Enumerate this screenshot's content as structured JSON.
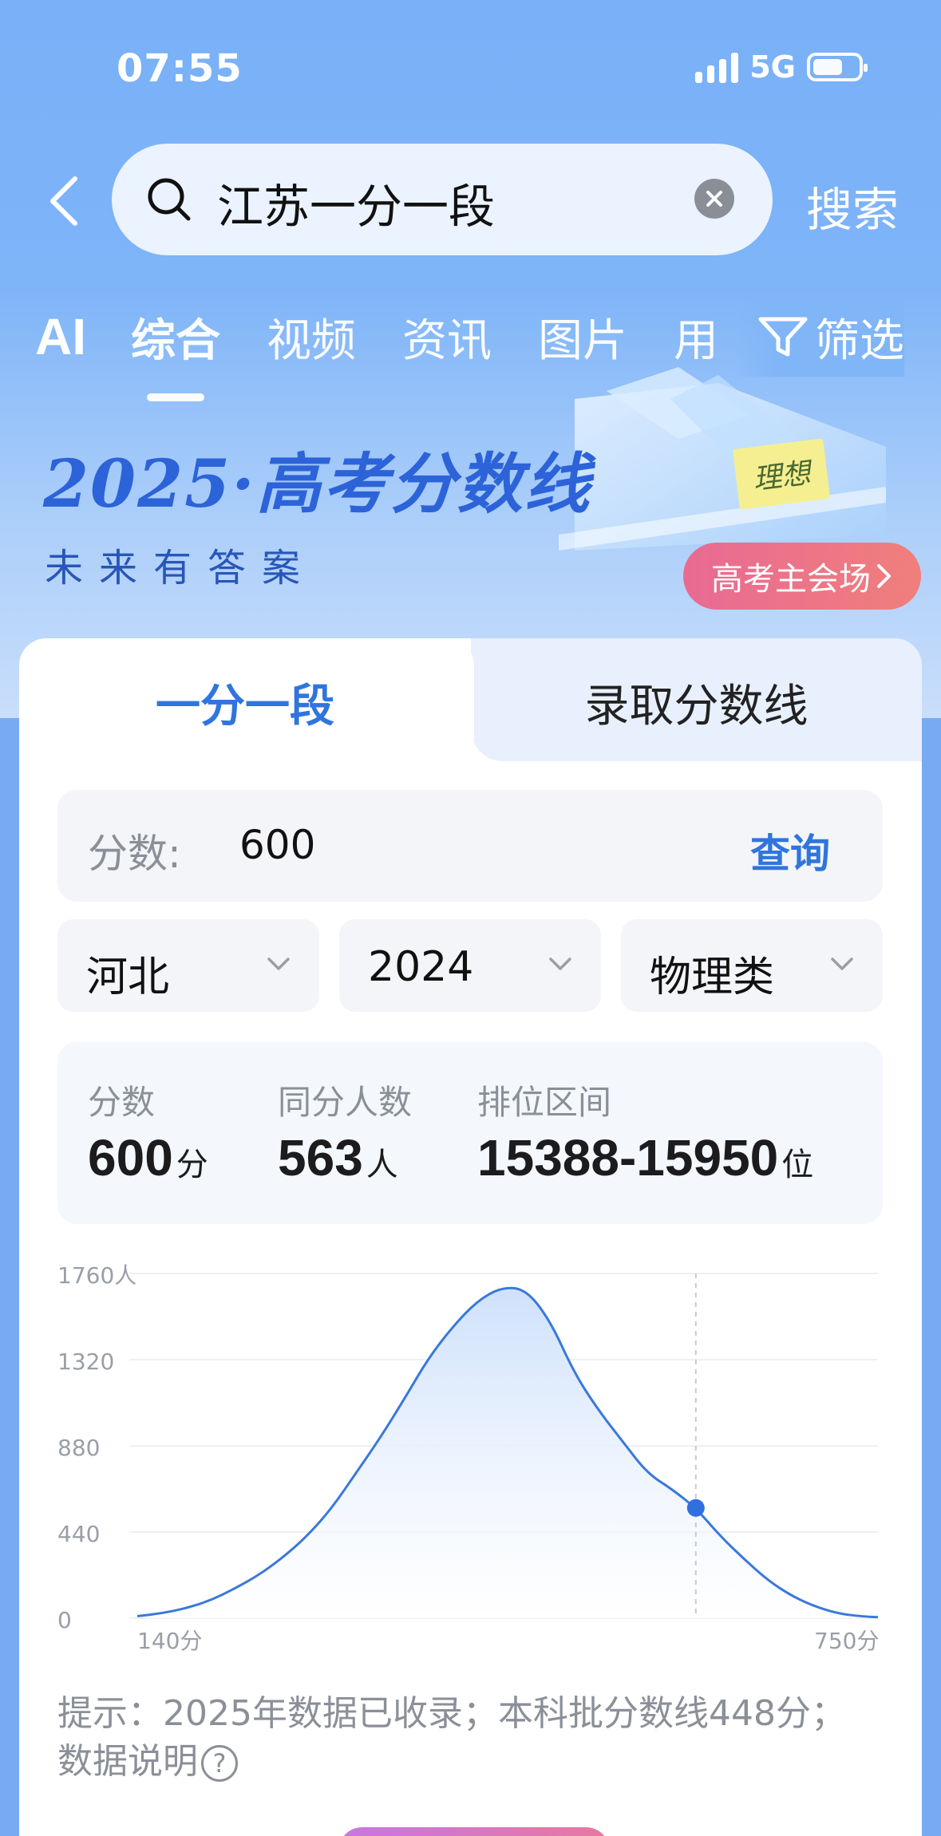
{
  "status": {
    "time": "07:55",
    "network": "5G"
  },
  "search": {
    "query": "江苏一分一段",
    "submit_label": "搜索"
  },
  "nav": {
    "ai_label": "AI",
    "tabs": [
      "综合",
      "视频",
      "资讯",
      "图片",
      "用"
    ],
    "filter_label": "筛选"
  },
  "banner": {
    "title": "2025·高考分数线",
    "subtitle": "未来有答案",
    "sticky_note": "理想",
    "cta_label": "高考主会场"
  },
  "card": {
    "tabs": [
      "一分一段",
      "录取分数线"
    ],
    "score": {
      "label": "分数:",
      "value": "600",
      "query_label": "查询"
    },
    "selects": {
      "province": "河北",
      "year": "2024",
      "subject": "物理类"
    },
    "stats": {
      "score": {
        "label": "分数",
        "value": "600",
        "unit": "分"
      },
      "same_count": {
        "label": "同分人数",
        "value": "563",
        "unit": "人"
      },
      "rank_range": {
        "label": "排位区间",
        "value": "15388-15950",
        "unit": "位"
      }
    },
    "tip": {
      "text": "提示：2025年数据已收录；本科批分数线448分；",
      "help_label": "数据说明"
    }
  },
  "chart_data": {
    "type": "area",
    "y_tick_labels": [
      "1760人",
      "1320",
      "880",
      "440",
      "0"
    ],
    "x_tick_labels": [
      "140分",
      "750分"
    ],
    "ylim": [
      0,
      1760
    ],
    "xlim": [
      140,
      750
    ],
    "marker": {
      "x": 600,
      "y": 563
    },
    "x": [
      140,
      160,
      180,
      200,
      220,
      240,
      260,
      280,
      300,
      320,
      340,
      360,
      380,
      400,
      420,
      440,
      460,
      480,
      500,
      520,
      540,
      560,
      580,
      600,
      620,
      640,
      660,
      680,
      700,
      720,
      740,
      750
    ],
    "values": [
      10,
      25,
      50,
      90,
      150,
      220,
      310,
      420,
      560,
      740,
      920,
      1120,
      1330,
      1490,
      1620,
      1690,
      1680,
      1520,
      1250,
      1060,
      900,
      740,
      660,
      563,
      420,
      300,
      190,
      110,
      55,
      20,
      8,
      5
    ],
    "colors": {
      "line": "#3a78dc",
      "fill_top": "#cfe1fb",
      "marker": "#2f6fe0"
    }
  }
}
